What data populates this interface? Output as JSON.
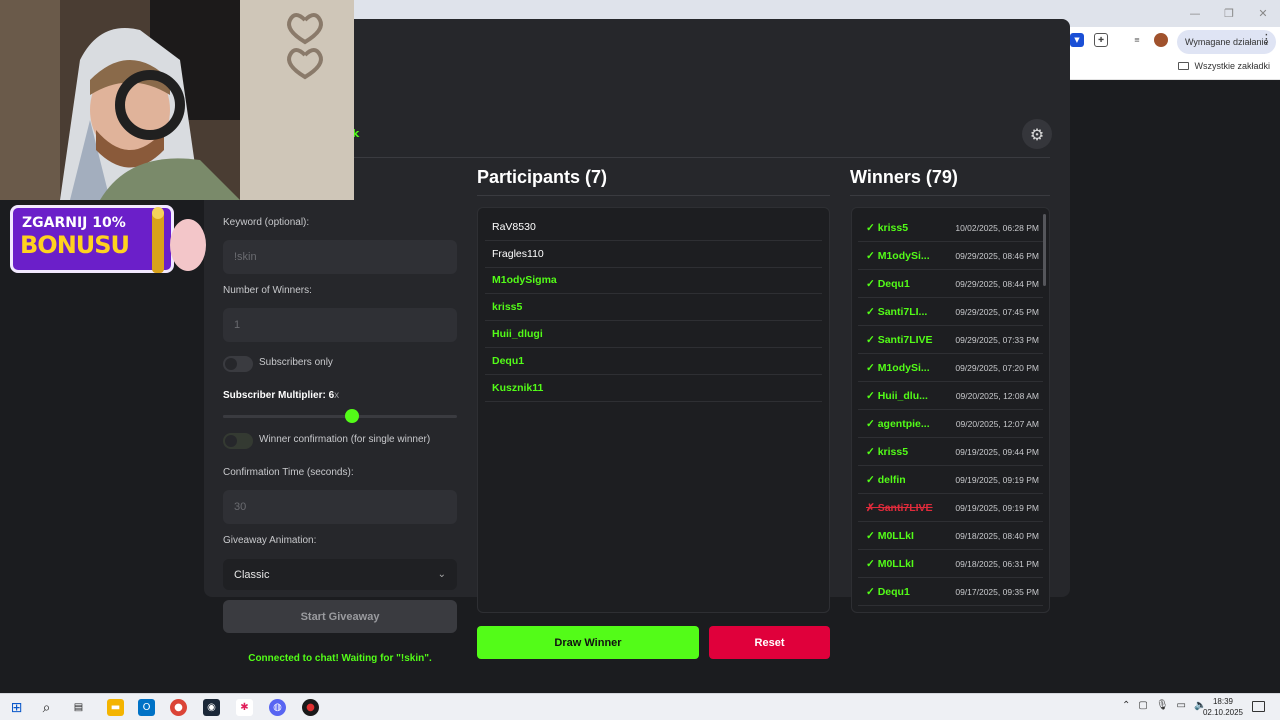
{
  "browser": {
    "action_required_label": "Wymagane działanie",
    "bookmarks_all_label": "Wszystkie zakładki"
  },
  "promo": {
    "top_text": "ZGARNIJ 10%",
    "main_text": "BONUSU"
  },
  "settings": {
    "keyword_label": "Keyword (optional):",
    "keyword_placeholder": "!skin",
    "num_winners_label": "Number of Winners:",
    "num_winners_value": "1",
    "subscribers_only_label": "Subscribers only",
    "subscribers_only_on": false,
    "multiplier_label": "Subscriber Multiplier: 6",
    "multiplier_suffix": "x",
    "multiplier_value": 6,
    "multiplier_fraction": 0.55,
    "confirmation_label": "Winner confirmation (for single winner)",
    "confirmation_on": false,
    "confirm_time_label": "Confirmation Time (seconds):",
    "confirm_time_value": "30",
    "animation_label": "Giveaway Animation:",
    "animation_value": "Classic",
    "start_label": "Start Giveaway",
    "status_text": "Connected to chat! Waiting for \"!skin\"."
  },
  "participants": {
    "title": "Participants (7)",
    "items": [
      {
        "name": "RaV8530",
        "subscriber": false
      },
      {
        "name": "Fragles110",
        "subscriber": false
      },
      {
        "name": "M1odySigma",
        "subscriber": true
      },
      {
        "name": "kriss5",
        "subscriber": true
      },
      {
        "name": "Huii_dlugi",
        "subscriber": true
      },
      {
        "name": "Dequ1",
        "subscriber": true
      },
      {
        "name": "Kusznik11",
        "subscriber": true
      }
    ],
    "draw_label": "Draw Winner",
    "reset_label": "Reset"
  },
  "winners": {
    "title": "Winners (79)",
    "items": [
      {
        "name": "✓ kriss5",
        "date": "10/02/2025, 06:28 PM",
        "lost": false
      },
      {
        "name": "✓ M1odySi...",
        "date": "09/29/2025, 08:46 PM",
        "lost": false
      },
      {
        "name": "✓ Dequ1",
        "date": "09/29/2025, 08:44 PM",
        "lost": false
      },
      {
        "name": "✓ Santi7LI...",
        "date": "09/29/2025, 07:45 PM",
        "lost": false
      },
      {
        "name": "✓ Santi7LIVE",
        "date": "09/29/2025, 07:33 PM",
        "lost": false
      },
      {
        "name": "✓ M1odySi...",
        "date": "09/29/2025, 07:20 PM",
        "lost": false
      },
      {
        "name": "✓ Huii_dlu...",
        "date": "09/20/2025, 12:08 AM",
        "lost": false
      },
      {
        "name": "✓ agentpie...",
        "date": "09/20/2025, 12:07 AM",
        "lost": false
      },
      {
        "name": "✓ kriss5",
        "date": "09/19/2025, 09:44 PM",
        "lost": false
      },
      {
        "name": "✓ delfin",
        "date": "09/19/2025, 09:19 PM",
        "lost": false
      },
      {
        "name": "✗ Santi7LIVE",
        "date": "09/19/2025, 09:19 PM",
        "lost": true
      },
      {
        "name": "✓ M0LLkI",
        "date": "09/18/2025, 08:40 PM",
        "lost": false
      },
      {
        "name": "✓ M0LLkI",
        "date": "09/18/2025, 06:31 PM",
        "lost": false
      },
      {
        "name": "✓ Dequ1",
        "date": "09/17/2025, 09:35 PM",
        "lost": false
      }
    ]
  },
  "taskbar": {
    "time": "18:39",
    "date": "02.10.2025"
  },
  "colors": {
    "accent": "#53fc18",
    "danger": "#e0003b",
    "panel": "#26272b",
    "background": "#1b1c1f"
  }
}
